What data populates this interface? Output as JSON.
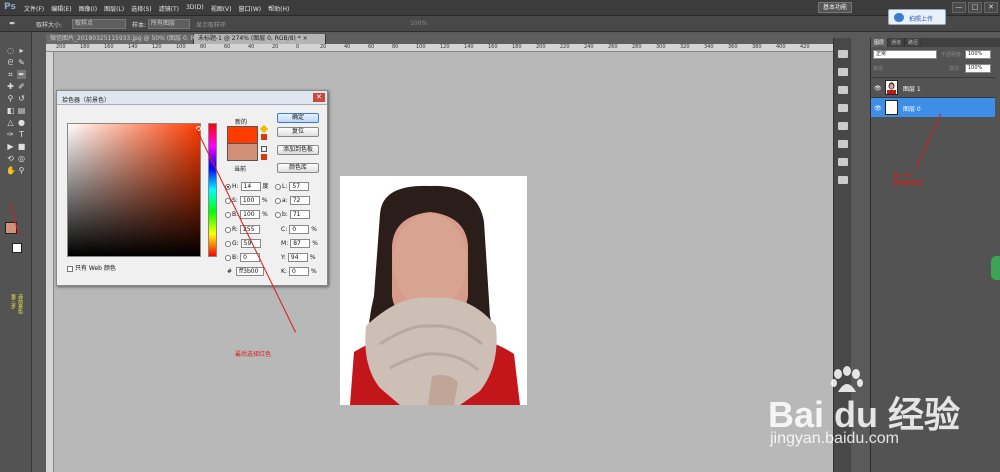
{
  "app": {
    "logo": "Ps",
    "menu": [
      "文件(F)",
      "编辑(E)",
      "图像(I)",
      "图层(L)",
      "选择(S)",
      "滤镜(T)",
      "3D(D)",
      "视图(V)",
      "窗口(W)",
      "帮助(H)"
    ],
    "workspace_button": "基本功能",
    "window_controls": [
      "—",
      "□",
      "✕"
    ],
    "upload_badge": "拍照上传"
  },
  "options_bar": {
    "sample_size_label": "取样大小:",
    "sample_size_value": "取样点",
    "sample_label": "样本:",
    "sample_value": "所有图层",
    "show_ring_label": "显示取样环",
    "zoom_value": "100%"
  },
  "tabs": [
    {
      "label": "微信图片_20180325115933.jpg @ 50% (图层 0, RGB/8#) *  ×"
    },
    {
      "label": "未标题-1 @ 274% (图层 0, RGB/8) *  ×"
    }
  ],
  "ruler_ticks": [
    "200",
    "180",
    "160",
    "140",
    "120",
    "100",
    "80",
    "60",
    "40",
    "20",
    "0",
    "20",
    "40",
    "60",
    "80",
    "100",
    "120",
    "140",
    "160",
    "180",
    "200",
    "220",
    "240",
    "260",
    "280",
    "300",
    "320",
    "340",
    "360",
    "380",
    "400",
    "420"
  ],
  "toolbox": {
    "note1": "第三步",
    "note2": "选前景色"
  },
  "picker": {
    "title": "拾色器（前景色）",
    "close": "✕",
    "label_new": "新的",
    "label_current": "当前",
    "new_color": "#ff3b00",
    "current_color": "#d09178",
    "buttons": {
      "ok": "确定",
      "reset": "复位",
      "add_swatch": "添加到色板",
      "libraries": "颜色库"
    },
    "web_only": "只有 Web 颜色",
    "fields": {
      "H": {
        "value": "14",
        "unit": "度"
      },
      "S": {
        "value": "100",
        "unit": "%"
      },
      "B": {
        "value": "100",
        "unit": "%"
      },
      "R": {
        "value": "255",
        "unit": ""
      },
      "G": {
        "value": "59",
        "unit": ""
      },
      "Bb": {
        "value": "0",
        "unit": ""
      },
      "L": {
        "value": "57",
        "unit": ""
      },
      "a": {
        "value": "72",
        "unit": ""
      },
      "b": {
        "value": "71",
        "unit": ""
      },
      "C": {
        "value": "0",
        "unit": "%"
      },
      "M": {
        "value": "87",
        "unit": "%"
      },
      "Y": {
        "value": "94",
        "unit": "%"
      },
      "K": {
        "value": "0",
        "unit": "%"
      },
      "hex": {
        "value": "ff3b00",
        "unit": ""
      }
    }
  },
  "layers_panel": {
    "tabs": [
      "图层",
      "通道",
      "路径"
    ],
    "blend_mode": "正常",
    "opacity_label": "不透明度:",
    "opacity_value": "100%",
    "lock_label": "锁定:",
    "fill_label": "填充:",
    "fill_value": "100%",
    "layers": [
      {
        "name": "图层 1",
        "selected": false
      },
      {
        "name": "图层 0",
        "selected": true
      }
    ]
  },
  "annotations": {
    "layer_note": "第一步\n两图层解锁",
    "picker_note": "最后选择红色"
  },
  "watermark": {
    "brand": "Bai  du 经验",
    "url": "jingyan.baidu.com"
  }
}
